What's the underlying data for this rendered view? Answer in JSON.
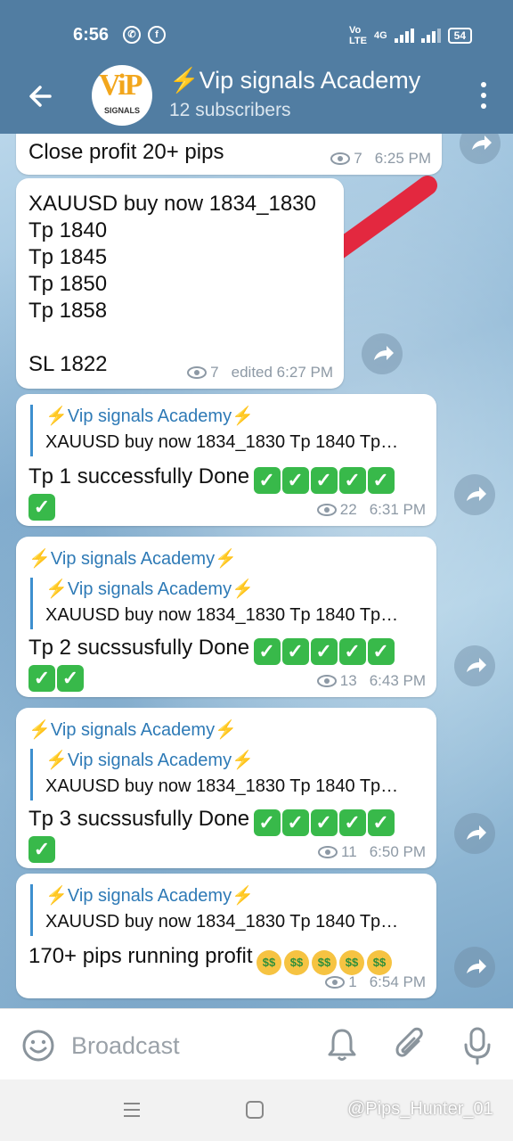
{
  "status_bar": {
    "time": "6:56",
    "network_label": "4G",
    "battery": "54"
  },
  "header": {
    "avatar_text": "ViP",
    "avatar_subtext": "SIGNALS",
    "title": "⚡Vip signals Academy",
    "subtitle": "12 subscribers"
  },
  "messages": [
    {
      "text": "Close profit 20+ pips",
      "views": "7",
      "time": "6:25 PM"
    },
    {
      "text": "XAUUSD buy now 1834_1830\nTp 1840\nTp 1845\nTp 1850\nTp 1858\n\nSL 1822",
      "views": "7",
      "time": "edited 6:27 PM"
    },
    {
      "quote_title": "⚡Vip signals Academy⚡",
      "quote_text": "XAUUSD buy now 1834_1830 Tp 1840 Tp…",
      "text": "Tp 1 successfully Done",
      "views": "22",
      "time": "6:31 PM"
    },
    {
      "forward_title": "⚡Vip signals Academy⚡",
      "quote_title": "⚡Vip signals Academy⚡",
      "quote_text": "XAUUSD buy now 1834_1830 Tp 1840 Tp…",
      "text": "Tp 2 sucssusfully Done",
      "views": "13",
      "time": "6:43 PM"
    },
    {
      "forward_title": "⚡Vip signals Academy⚡",
      "quote_title": "⚡Vip signals Academy⚡",
      "quote_text": "XAUUSD buy now 1834_1830 Tp 1840 Tp…",
      "text": "Tp 3 sucssusfully Done",
      "views": "11",
      "time": "6:50 PM"
    },
    {
      "quote_title": "⚡Vip signals Academy⚡",
      "quote_text": "XAUUSD buy now 1834_1830 Tp 1840 Tp…",
      "text": "170+ pips running profit",
      "views": "1",
      "time": "6:54 PM"
    }
  ],
  "input": {
    "placeholder": "Broadcast"
  },
  "watermark": "@Pips_Hunter_01",
  "colors": {
    "header": "#517da2",
    "link": "#2e7ab6",
    "check": "#38b94a"
  },
  "icons": [
    "back-arrow-icon",
    "more-vert-icon",
    "eye-icon",
    "share-icon",
    "emoji-icon",
    "bell-icon",
    "attach-icon",
    "mic-icon",
    "check-mark-icon",
    "money-face-icon"
  ]
}
